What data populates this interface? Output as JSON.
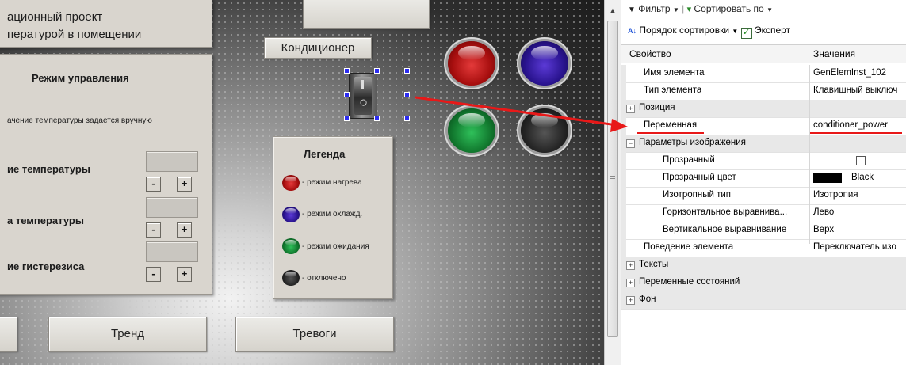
{
  "canvas": {
    "project_title_line1": "ационный проект",
    "project_title_line2": "пературой в помещении",
    "conditioner_label": "Кондиционер",
    "mode_title": "Режим управления",
    "mode_desc": "ачение температуры задается вручную",
    "row1_label": "ие температуры",
    "row2_label": "а температуры",
    "row3_label": "ие гистерезиса",
    "minus": "-",
    "plus": "+",
    "legend": {
      "title": "Легенда",
      "items": [
        {
          "text": "- режим нагрева",
          "color": "red"
        },
        {
          "text": "- режим охлажд.",
          "color": "blue"
        },
        {
          "text": "- режим ожидания",
          "color": "green"
        },
        {
          "text": "- отключено",
          "color": "black"
        }
      ]
    },
    "trend_button": "Тренд",
    "alarms_button": "Тревоги",
    "switch_glyph": "○"
  },
  "properties": {
    "toolbar": {
      "filter_label": "Фильтр",
      "sort_by_label": "Сортировать по",
      "sort_order_label": "Порядок сортировки",
      "expert_label": "Эксперт",
      "expert_checked": true
    },
    "columns": {
      "property": "Свойство",
      "values": "Значения"
    },
    "rows": [
      {
        "name": "Имя элемента",
        "value": "GenElemInst_102"
      },
      {
        "name": "Тип элемента",
        "value": "Клавишный выключ"
      },
      {
        "name": "Позиция",
        "value": "",
        "category": "+"
      },
      {
        "name": "Переменная",
        "value": "conditioner_power"
      },
      {
        "name": "Параметры изображения",
        "value": "",
        "category": "−"
      },
      {
        "name": "Прозрачный",
        "value": ""
      },
      {
        "name": "Прозрачный цвет",
        "value": "Black"
      },
      {
        "name": "Изотропный тип",
        "value": "Изотропия"
      },
      {
        "name": "Горизонтальное выравнива...",
        "value": "Лево"
      },
      {
        "name": "Вертикальное выравнивание",
        "value": "Верх"
      },
      {
        "name": "Поведение элемента",
        "value": "Переключатель изо"
      },
      {
        "name": "Тексты",
        "value": "",
        "category": "+"
      },
      {
        "name": "Переменные состояний",
        "value": "",
        "category": "+"
      },
      {
        "name": "Фон",
        "value": "",
        "category": "+"
      }
    ]
  },
  "colors": {
    "accent_arrow": "#e81818",
    "selection_handle": "#2c2cf0",
    "underline": "#e81818"
  }
}
